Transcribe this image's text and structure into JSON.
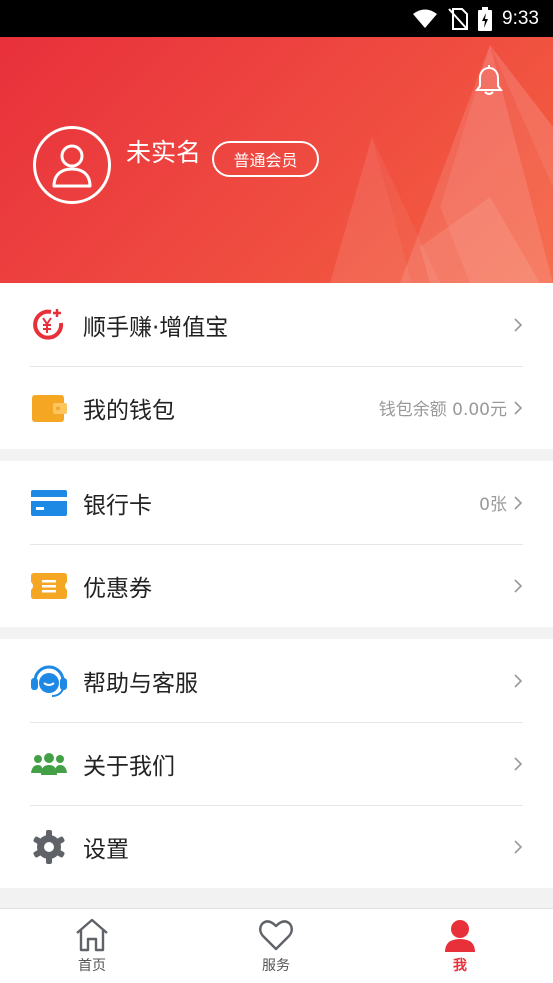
{
  "status_bar": {
    "time": "9:33"
  },
  "header": {
    "username": "未实名",
    "member_level": "普通会员"
  },
  "menu": {
    "group1": [
      {
        "label": "顺手赚·增值宝",
        "value": ""
      },
      {
        "label": "我的钱包",
        "value": "钱包余额 0.00元"
      }
    ],
    "group2": [
      {
        "label": "银行卡",
        "value": "0张"
      },
      {
        "label": "优惠券",
        "value": ""
      }
    ],
    "group3": [
      {
        "label": "帮助与客服",
        "value": ""
      },
      {
        "label": "关于我们",
        "value": ""
      },
      {
        "label": "设置",
        "value": ""
      }
    ]
  },
  "bottom_nav": [
    {
      "label": "首页",
      "icon": "home-icon",
      "active": false
    },
    {
      "label": "服务",
      "icon": "heart-icon",
      "active": false
    },
    {
      "label": "我",
      "icon": "person-icon",
      "active": true
    }
  ],
  "colors": {
    "brand_red": "#e8303b",
    "icon_orange": "#f5a623",
    "icon_blue": "#1e88e5",
    "icon_green": "#43a047",
    "icon_gray": "#5f6368"
  }
}
